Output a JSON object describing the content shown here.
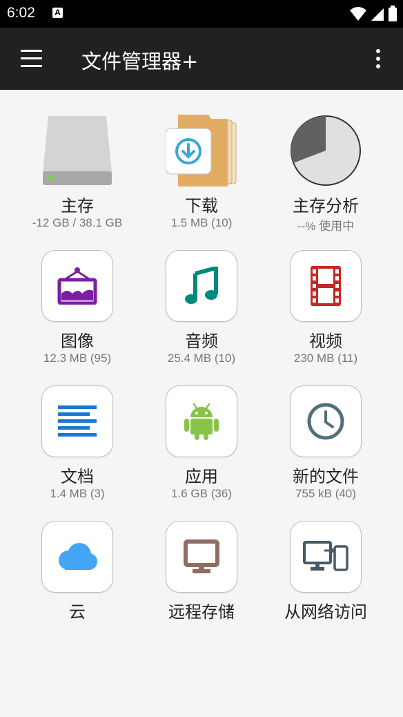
{
  "status_bar": {
    "time": "6:02",
    "notification_badge": "A"
  },
  "app_bar": {
    "title": "文件管理器+"
  },
  "tiles": [
    {
      "label": "主存",
      "sub": "-12 GB / 38.1 GB",
      "icon": "hard-drive-icon"
    },
    {
      "label": "下载",
      "sub": "1.5 MB (10)",
      "icon": "download-folder-icon"
    },
    {
      "label": "主存分析",
      "sub": "--% 使用中",
      "icon": "pie-chart-icon"
    },
    {
      "label": "图像",
      "sub": "12.3 MB (95)",
      "icon": "image-frame-icon",
      "color": "#7b1fa2"
    },
    {
      "label": "音频",
      "sub": "25.4 MB (10)",
      "icon": "music-note-icon",
      "color": "#00897b"
    },
    {
      "label": "视频",
      "sub": "230 MB (11)",
      "icon": "film-strip-icon",
      "color": "#c62828"
    },
    {
      "label": "文档",
      "sub": "1.4 MB (3)",
      "icon": "document-lines-icon",
      "color": "#1976d2"
    },
    {
      "label": "应用",
      "sub": "1.6 GB (36)",
      "icon": "android-icon",
      "color": "#8bc34a"
    },
    {
      "label": "新的文件",
      "sub": "755 kB (40)",
      "icon": "clock-icon",
      "color": "#546e7a"
    },
    {
      "label": "云",
      "sub": "",
      "icon": "cloud-icon",
      "color": "#42a5f5"
    },
    {
      "label": "远程存储",
      "sub": "",
      "icon": "monitor-icon",
      "color": "#8d6e63"
    },
    {
      "label": "从网络访问",
      "sub": "",
      "icon": "network-devices-icon",
      "color": "#455a64"
    }
  ]
}
